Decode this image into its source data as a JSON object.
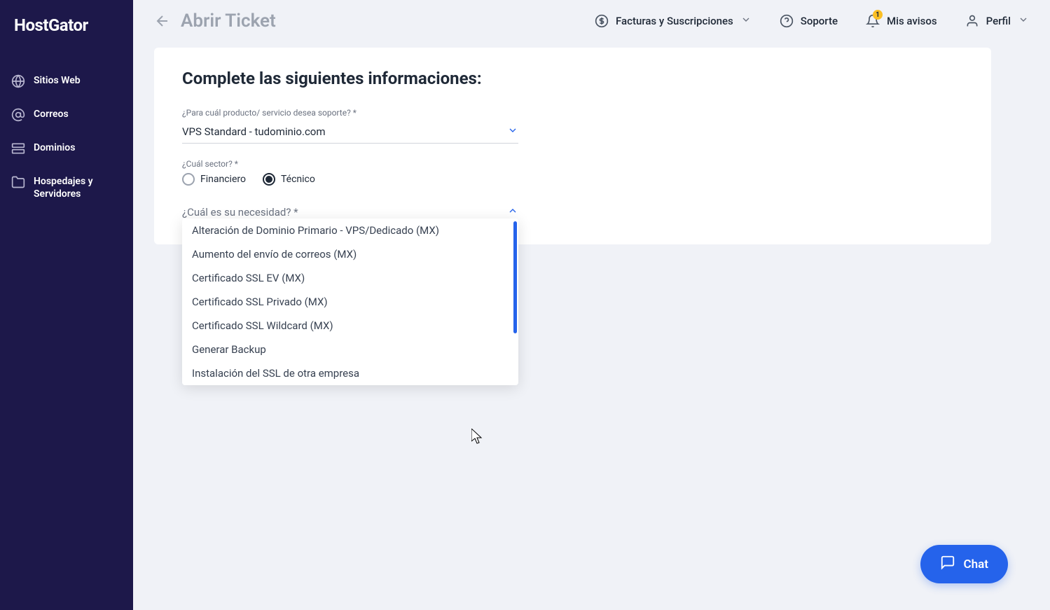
{
  "logo": "HostGator",
  "sidebar": {
    "items": [
      {
        "label": "Sitios Web",
        "icon": "globe"
      },
      {
        "label": "Correos",
        "icon": "at"
      },
      {
        "label": "Dominios",
        "icon": "server"
      },
      {
        "label": "Hospedajes y Servidores",
        "icon": "folder"
      }
    ]
  },
  "page": {
    "title": "Abrir Ticket"
  },
  "header": {
    "billing": "Facturas y Suscripciones",
    "support": "Soporte",
    "notices": "Mis avisos",
    "notice_badge": "1",
    "profile": "Perfil"
  },
  "form": {
    "title": "Complete las siguientes informaciones:",
    "product_label": "¿Para cuál producto/ servicio desea soporte? *",
    "product_value": "VPS Standard - tudominio.com",
    "sector_label": "¿Cuál sector? *",
    "sector_options": [
      {
        "label": "Financiero",
        "selected": false
      },
      {
        "label": "Técnico",
        "selected": true
      }
    ],
    "need_label": "¿Cuál es su necesidad? *"
  },
  "dropdown": {
    "options": [
      "Alteración de Dominio Primario - VPS/Dedicado (MX)",
      "Aumento del envío de correos (MX)",
      "Certificado SSL EV (MX)",
      "Certificado SSL Privado (MX)",
      "Certificado SSL Wildcard (MX)",
      "Generar Backup",
      "Instalación del SSL de otra empresa"
    ]
  },
  "chat": {
    "label": "Chat"
  }
}
